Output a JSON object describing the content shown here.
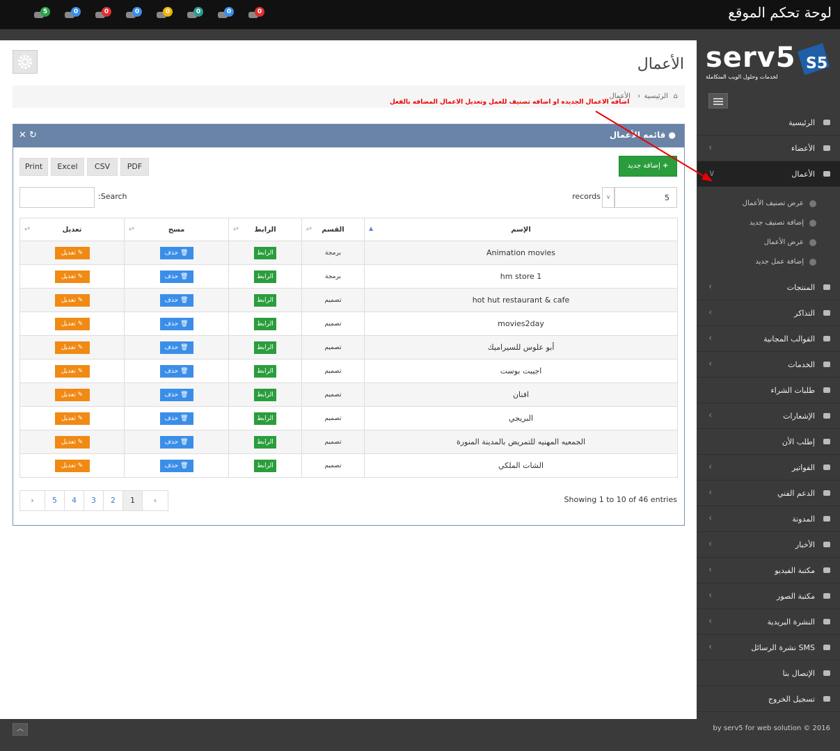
{
  "header": {
    "title": "لوحة تحكم الموقع",
    "notifications": [
      {
        "icon": "twitter-bird-icon",
        "count": "5",
        "color": "#2aa34a"
      },
      {
        "icon": "plus-users-icon",
        "count": "0",
        "color": "#3b8ee8"
      },
      {
        "icon": "user-icon",
        "count": "0",
        "color": "#e03030"
      },
      {
        "icon": "chat-icon",
        "count": "0",
        "color": "#3b8ee8"
      },
      {
        "icon": "tag-icon",
        "count": "0",
        "color": "#f0b400"
      },
      {
        "icon": "truck-icon",
        "count": "0",
        "color": "#2a9d8f"
      },
      {
        "icon": "envelope-icon",
        "count": "0",
        "color": "#3b8ee8"
      },
      {
        "icon": "user-icon",
        "count": "0",
        "color": "#e03030"
      }
    ]
  },
  "logo": {
    "word": "serv5",
    "tagline": "لخدمات وحلول الويب المتكاملة"
  },
  "sidebar": {
    "items": [
      {
        "label": "الرئيسية",
        "chev": false
      },
      {
        "label": "الأعضاء",
        "chev": true
      },
      {
        "label": "الأعمال",
        "chev": true,
        "active": true
      }
    ],
    "subitems": [
      "عرض تصنيف الأعمال",
      "إضافة تصنيف جديد",
      "عرض الأعمال",
      "إضافة عمل جديد"
    ],
    "items2": [
      {
        "label": "المنتجات",
        "chev": true
      },
      {
        "label": "التذاكر",
        "chev": true
      },
      {
        "label": "القوالب المجانية",
        "chev": true
      },
      {
        "label": "الخدمات",
        "chev": true
      },
      {
        "label": "طلبات الشراء",
        "chev": false
      },
      {
        "label": "الإشعارات",
        "chev": true
      },
      {
        "label": "إطلب الأن",
        "chev": false
      },
      {
        "label": "الفواتير",
        "chev": true
      },
      {
        "label": "الدعم الفني",
        "chev": true
      },
      {
        "label": "المدونة",
        "chev": true
      },
      {
        "label": "الأخبار",
        "chev": true
      },
      {
        "label": "مكتبة الفيديو",
        "chev": true
      },
      {
        "label": "مكتبة الصور",
        "chev": true
      },
      {
        "label": "النشرة البريدية",
        "chev": true
      },
      {
        "label": "نشرة الرسائل SMS",
        "chev": true
      },
      {
        "label": "الإتصال بنا",
        "chev": false
      },
      {
        "label": "تسجيل الخروج",
        "chev": false
      }
    ]
  },
  "page": {
    "title": "الأعمال",
    "breadcrumb": {
      "home": "الرئيسية",
      "current": "الأعمال"
    },
    "note": "اضافه الاعمال الجديده او اضافه تصنيف للعمل وتعديل الاعمال المضافه بالفعل"
  },
  "panel": {
    "title": "قائمه الأعمال",
    "add_label": "إضافة جديد",
    "export": [
      "Print",
      "Excel",
      "CSV",
      "PDF"
    ],
    "records_value": "5",
    "records_label": "records",
    "search_label": ":Search",
    "columns": {
      "name": "الإسم",
      "category": "القسم",
      "link": "الرابط",
      "delete": "مسح",
      "edit": "تعديل"
    },
    "link_btn": "الرابط",
    "delete_btn": "حذف",
    "edit_btn": "تعديل",
    "rows": [
      {
        "name": "Animation movies",
        "category": "برمجة"
      },
      {
        "name": "hm store 1",
        "category": "برمجة"
      },
      {
        "name": "hot hut restaurant & cafe",
        "category": "تصميم"
      },
      {
        "name": "movies2day",
        "category": "تصميم"
      },
      {
        "name": "أبو علوس للسيراميك",
        "category": "تصميم"
      },
      {
        "name": "اجيبت بوست",
        "category": "تصميم"
      },
      {
        "name": "افنان",
        "category": "تصميم"
      },
      {
        "name": "البريجي",
        "category": "تصميم"
      },
      {
        "name": "الجمعيه المهنيه للتمريض بالمدينة المنورة",
        "category": "تصميم"
      },
      {
        "name": "الشات الملكي",
        "category": "تصميم"
      }
    ],
    "showing": "Showing 1 to 10 of 46 entries",
    "pager": [
      "›",
      "5",
      "4",
      "3",
      "2",
      "1",
      "‹"
    ]
  },
  "footer": {
    "copy": "by serv5 for web solution © 2016",
    "up": "︿"
  }
}
